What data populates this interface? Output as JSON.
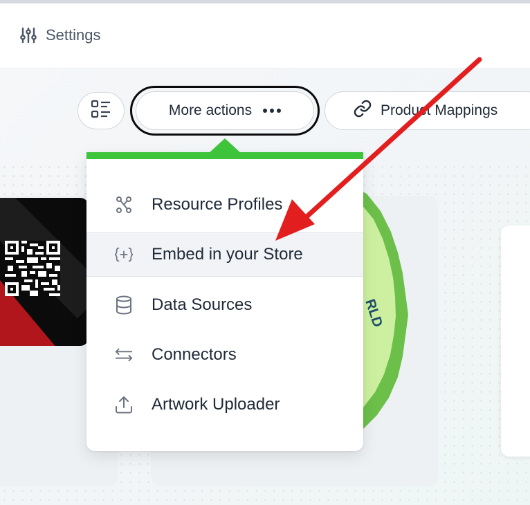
{
  "header": {
    "settings_label": "Settings"
  },
  "toolbar": {
    "more_actions_label": "More actions",
    "product_mappings_label": "Product Mappings"
  },
  "menu": {
    "items": [
      {
        "label": "Resource Profiles",
        "icon": "graph-nodes-icon"
      },
      {
        "label": "Embed in your Store",
        "icon": "embed-braces-icon"
      },
      {
        "label": "Data Sources",
        "icon": "database-icon"
      },
      {
        "label": "Connectors",
        "icon": "arrows-left-right-icon"
      },
      {
        "label": "Artwork Uploader",
        "icon": "upload-icon"
      }
    ],
    "highlighted_index": 1
  },
  "background": {
    "seal_text": "RLD"
  },
  "colors": {
    "accent_green": "#3ec43b",
    "annotation_arrow": "#e31e1e",
    "seal_green": "#6cc04a",
    "seal_light": "#cdf0a0",
    "text_dark": "#1f2937",
    "icon_gray": "#6b7280"
  }
}
